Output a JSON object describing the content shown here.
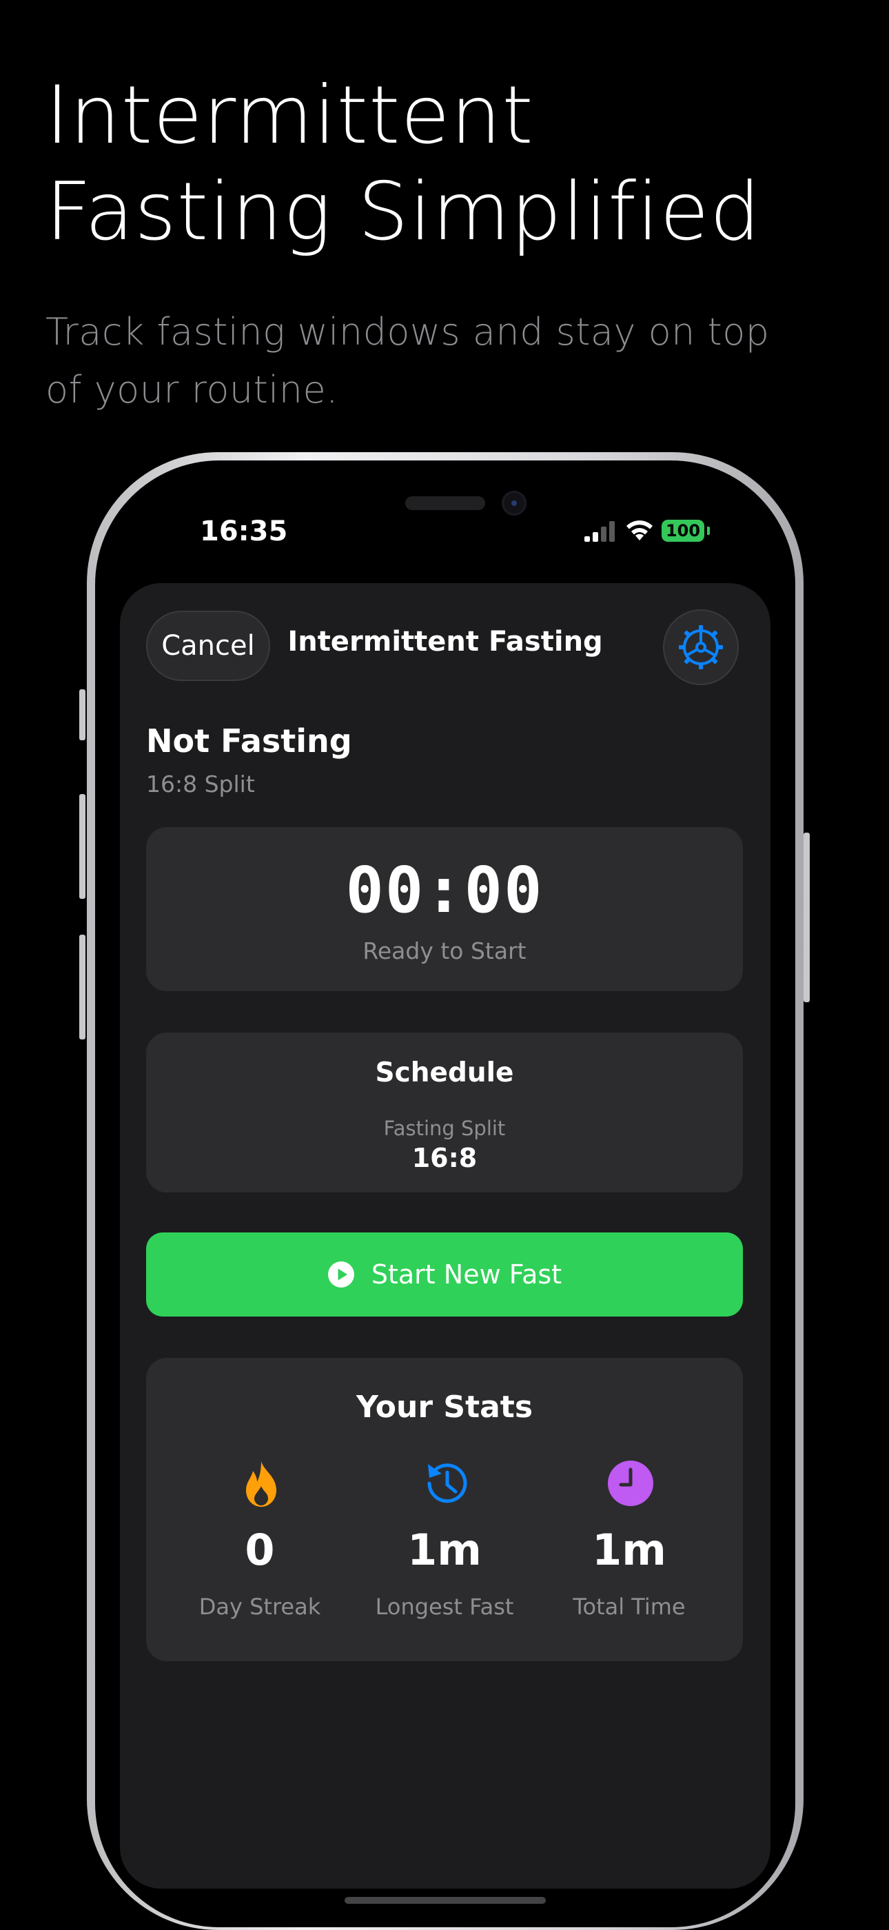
{
  "marketing": {
    "headline_line1": "Intermittent",
    "headline_line2": "Fasting Simplified",
    "subline": "Track fasting windows and stay on top of your routine."
  },
  "status_bar": {
    "time": "16:35",
    "battery": "100",
    "battery_color": "#34c759"
  },
  "nav": {
    "cancel_label": "Cancel",
    "title": "Intermittent Fasting",
    "settings_icon": "gear-icon",
    "accent": "#0a84ff"
  },
  "fasting_state": {
    "title": "Not Fasting",
    "split": "16:8 Split"
  },
  "timer": {
    "value": "00:00",
    "label": "Ready to Start"
  },
  "schedule": {
    "title": "Schedule",
    "label": "Fasting Split",
    "value": "16:8"
  },
  "start_button": {
    "label": "Start New Fast",
    "icon": "play-circle-icon",
    "color": "#30d158"
  },
  "stats": {
    "title": "Your Stats",
    "items": [
      {
        "icon": "flame-icon",
        "color": "#ff9f0a",
        "value": "0",
        "label": "Day Streak"
      },
      {
        "icon": "history-clock-icon",
        "color": "#0a84ff",
        "value": "1m",
        "label": "Longest Fast"
      },
      {
        "icon": "clock-icon",
        "color": "#bf5af2",
        "value": "1m",
        "label": "Total Time"
      }
    ]
  }
}
